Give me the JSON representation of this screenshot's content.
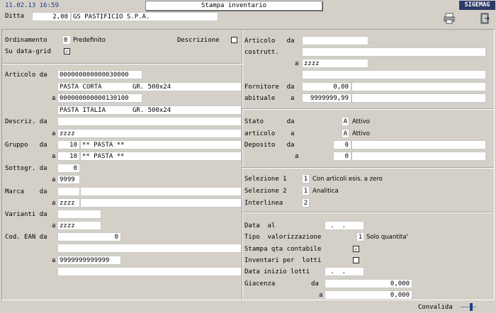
{
  "header": {
    "datetime": "11.02.13 16:59",
    "title": "Stampa inventario",
    "app": "SIGEMAG"
  },
  "ditta": {
    "label": "Ditta",
    "code": "2,00",
    "name": "GS PASTIFICIO S.P.A."
  },
  "toolbar": {
    "print_icon": "printer-icon",
    "exit_icon": "exit-door-icon"
  },
  "left": {
    "ordinamento": {
      "label": "Ordinamento",
      "value": "0",
      "text": "Predefinito"
    },
    "descrizione_label": "Descrizione",
    "su_data_grid": "Su data-grid",
    "articolo_da_label": "Articolo da",
    "articolo_da": "000000000000030000",
    "articolo_da_desc": "PASTA CORTA        GR. 500x24",
    "a_label": "a",
    "articolo_a": "000000000000130100",
    "articolo_a_desc": "PASTA ITALIA       GR. 500x24",
    "descriz_label": "Descriz. da",
    "descriz_a": "zzzz",
    "gruppo_label": "Gruppo   da",
    "gruppo_da_code": "10",
    "gruppo_da_desc": "** PASTA **",
    "gruppo_a_code": "10",
    "gruppo_a_desc": "** PASTA **",
    "sottogr_label": "Sottogr. da",
    "sottogr_da": "0",
    "sottogr_a": "9999",
    "marca_label": "Marca    da",
    "marca_a": "zzzz",
    "varianti_label": "Varianti da",
    "varianti_a": "zzzz",
    "ean_label": "Cod. EAN da",
    "ean_da": "0",
    "ean_a": "9999999999999"
  },
  "right": {
    "articolo_costr_label1": "Articolo   da",
    "articolo_costr_label2": "costrutt.",
    "articolo_costr_a": "zzzz",
    "fornitore_label1": "Fornitore  da",
    "fornitore_label2": "abituale    a",
    "fornitore_da": "0,00",
    "fornitore_a": "9999999,99",
    "stato_label1": "Stato      da",
    "stato_label2": "articolo    a",
    "stato_da_code": "A",
    "stato_da_text": "Attivo",
    "stato_a_code": "A",
    "stato_a_text": "Attivo",
    "deposito_label": "Deposito   da",
    "deposito_da": "0",
    "deposito_a": "0",
    "selezione1_label": "Selezione 1",
    "selezione1_value": "1",
    "selezione1_text": "Con articoli esis. a zero",
    "selezione2_label": "Selezione 2",
    "selezione2_value": "1",
    "selezione2_text": "Analitica",
    "interlinea_label": "Interlinea",
    "interlinea_value": "2",
    "data_al_label": "Data  al",
    "data_al": " .  .     0",
    "tipo_val_label": "Tipo  valorizzazione",
    "tipo_val_value": "1",
    "tipo_val_text": "Solo quantita'",
    "stampa_qta_label": "Stampa qta contabile",
    "inventari_label": "Inventari per  lotti",
    "data_inizio_label": "Data inizio lotti",
    "data_inizio": " .  .     0",
    "giacenza_label": "Giacenza",
    "giacenza_da_label": "da",
    "giacenza_da": "0,000",
    "giacenza_a": "0,000"
  },
  "footer": {
    "convalida": "Convalida"
  }
}
